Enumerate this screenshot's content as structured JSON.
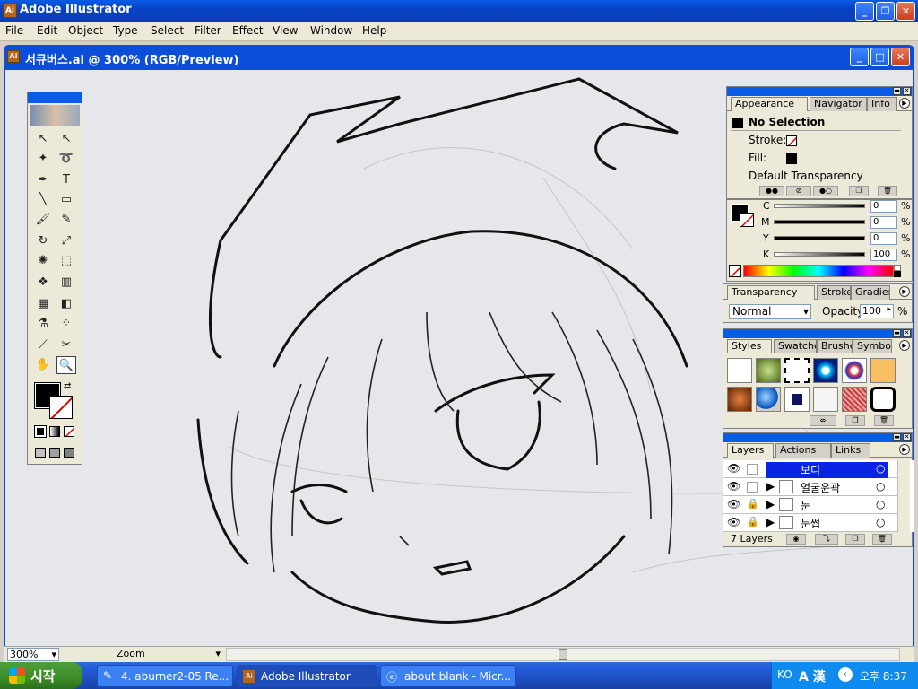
{
  "app": {
    "title": "Adobe Illustrator",
    "logo": "Ai"
  },
  "menu": [
    "File",
    "Edit",
    "Object",
    "Type",
    "Select",
    "Filter",
    "Effect",
    "View",
    "Window",
    "Help"
  ],
  "doc": {
    "title": "서큐버스.ai @ 300% (RGB/Preview)"
  },
  "status": {
    "zoom": "300%",
    "label": "Zoom"
  },
  "appearance": {
    "tabs": [
      "Appearance",
      "Navigator",
      "Info"
    ],
    "selection": "No Selection",
    "stroke_label": "Stroke:",
    "fill_label": "Fill:",
    "transparency": "Default Transparency"
  },
  "color": {
    "channels": [
      {
        "name": "C",
        "value": "0"
      },
      {
        "name": "M",
        "value": "0"
      },
      {
        "name": "Y",
        "value": "0"
      },
      {
        "name": "K",
        "value": "100"
      }
    ],
    "unit": "%"
  },
  "transparency": {
    "tabs": [
      "Transparency",
      "Stroke",
      "Gradient"
    ],
    "mode": "Normal",
    "opacity_label": "Opacity:",
    "opacity": "100",
    "unit": "%"
  },
  "styles": {
    "tabs": [
      "Styles",
      "Swatches",
      "Brushes",
      "Symbols"
    ]
  },
  "layers": {
    "tabs": [
      "Layers",
      "Actions",
      "Links"
    ],
    "items": [
      {
        "name": "보디"
      },
      {
        "name": "얼굴윤곽"
      },
      {
        "name": "눈"
      },
      {
        "name": "눈썹"
      }
    ],
    "count": "7 Layers"
  },
  "taskbar": {
    "start": "시작",
    "buttons": [
      "4. aburner2-05 Re...",
      "Adobe Illustrator",
      "about:blank - Micr..."
    ],
    "ime": "KO",
    "ime2": "A 漢",
    "clock": "오후 8:37"
  },
  "colors": {
    "title_blue": "#0a5ce6",
    "selection_blue": "#0a24e6"
  }
}
